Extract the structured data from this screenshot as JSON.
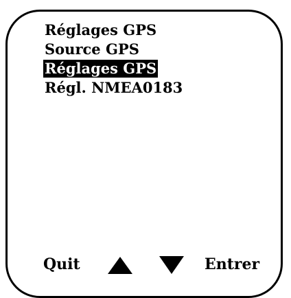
{
  "menu": {
    "title": "Réglages GPS",
    "items": [
      {
        "label": "Source GPS",
        "selected": false
      },
      {
        "label": "Réglages GPS",
        "selected": true
      },
      {
        "label": "Régl. NMEA0183",
        "selected": false
      }
    ]
  },
  "softkeys": {
    "left_label": "Quit",
    "up_icon": "up-arrow-icon",
    "down_icon": "down-arrow-icon",
    "right_label": "Entrer"
  },
  "colors": {
    "foreground": "#000000",
    "background": "#ffffff",
    "highlight_background": "#000000",
    "highlight_text": "#ffffff"
  }
}
